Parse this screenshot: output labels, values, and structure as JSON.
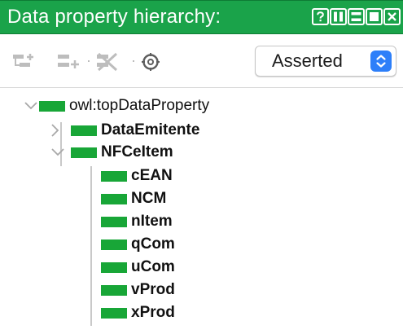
{
  "window": {
    "title": "Data property hierarchy:",
    "controls": [
      "help-icon",
      "split-view-icon",
      "minimize-icon",
      "maximize-icon",
      "close-icon"
    ]
  },
  "toolbar": {
    "buttons": [
      {
        "name": "add-subproperty-icon",
        "enabled": false
      },
      {
        "name": "add-sibling-property-icon",
        "enabled": false
      },
      {
        "name": "delete-property-icon",
        "enabled": false
      },
      {
        "name": "find-usage-icon",
        "enabled": true
      }
    ],
    "mode_select": {
      "value": "Asserted"
    }
  },
  "colors": {
    "titlebar": "#1aa34a",
    "property_bar": "#18a637",
    "select_accent": "#2d7ff9"
  },
  "tree": {
    "root": {
      "label": "owl:topDataProperty",
      "expanded": true
    },
    "children": [
      {
        "label": "DataEmitente",
        "expanded": false,
        "has_children": true
      },
      {
        "label": "NFCeItem",
        "expanded": true,
        "has_children": true,
        "children": [
          {
            "label": "cEAN"
          },
          {
            "label": "NCM"
          },
          {
            "label": "nItem"
          },
          {
            "label": "qCom"
          },
          {
            "label": "uCom"
          },
          {
            "label": "vProd"
          },
          {
            "label": "xProd"
          }
        ]
      }
    ]
  }
}
